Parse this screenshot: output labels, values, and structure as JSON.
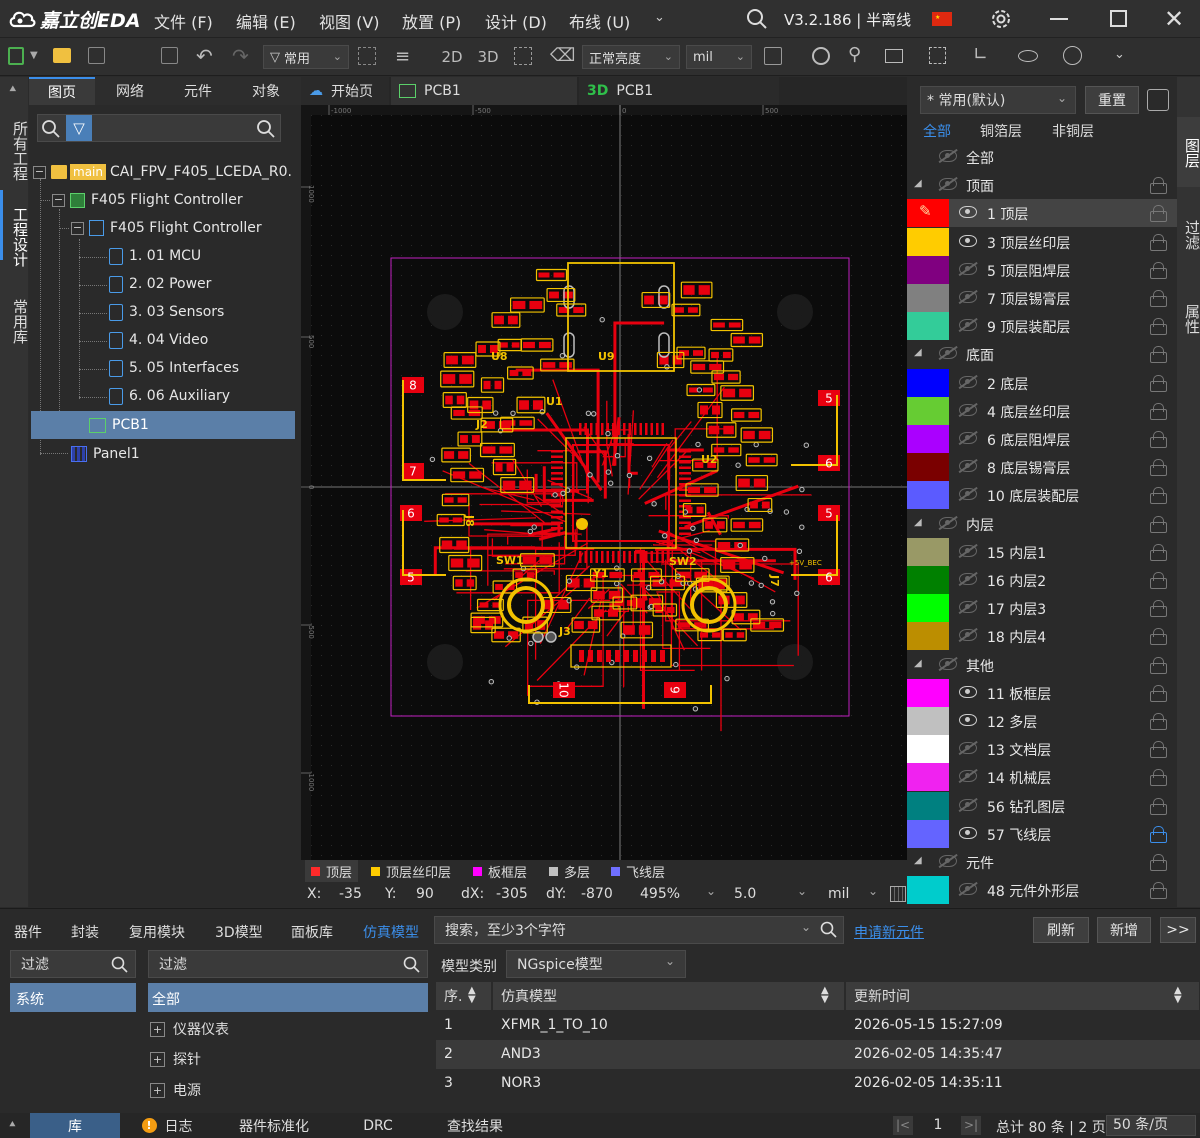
{
  "app": {
    "logo_text": "嘉立创EDA",
    "version_text": "V3.2.186 | 半离线"
  },
  "menu": [
    "文件 (F)",
    "编辑 (E)",
    "视图 (V)",
    "放置 (P)",
    "设计 (D)",
    "布线 (U)"
  ],
  "toolbar": {
    "filter_label": "常用",
    "view_2d": "2D",
    "view_3d": "3D",
    "brightness": "正常亮度",
    "unit": "mil"
  },
  "left_rail": [
    "所有工程",
    "工程设计",
    "常用库"
  ],
  "left_tabs": [
    "图页",
    "网络",
    "元件",
    "对象"
  ],
  "tree": {
    "root": {
      "branch": "main",
      "name": "CAI_FPV_F405_LCEDA_R0."
    },
    "board": "F405 Flight Controller",
    "schematic": "F405 Flight Controller",
    "sheets": [
      "1. 01 MCU",
      "2. 02 Power",
      "3. 03 Sensors",
      "4. 04 Video",
      "5. 05 Interfaces",
      "6. 06 Auxiliary"
    ],
    "pcb": "PCB1",
    "panel": "Panel1"
  },
  "doc_tabs": [
    "开始页",
    "PCB1",
    "PCB1"
  ],
  "doc_tab_prefix_3d": "3D",
  "ruler": {
    "h": [
      "-1000",
      "-500",
      "0",
      "500"
    ],
    "v": [
      "1000",
      "500",
      "0",
      "-500",
      "-1000"
    ]
  },
  "pcb_labels": {
    "refs": [
      "U8",
      "U9",
      "U1",
      "U2",
      "J2",
      "J8",
      "J7",
      "Y1",
      "SW1",
      "SW2",
      "J3"
    ],
    "pads": [
      "8",
      "7",
      "6",
      "5",
      "5",
      "6",
      "5",
      "6",
      "10",
      "9"
    ],
    "net": "+5V_BEC"
  },
  "layer_bar": [
    {
      "name": "顶层",
      "color": "#ff2a2a"
    },
    {
      "name": "顶层丝印层",
      "color": "#ffcc00"
    },
    {
      "name": "板框层",
      "color": "#ff00ff"
    },
    {
      "name": "多层",
      "color": "#c0c0c0"
    },
    {
      "name": "飞线层",
      "color": "#6f6fff"
    }
  ],
  "coords": {
    "x_label": "X:",
    "x": "-35",
    "y_label": "Y:",
    "y": "90",
    "dx_label": "dX:",
    "dx": "-305",
    "dy_label": "dY:",
    "dy": "-870",
    "zoom": "495%",
    "grid": "5.0",
    "unit": "mil"
  },
  "right_panel": {
    "preset": "* 常用(默认)",
    "reset": "重置",
    "filter_tabs": [
      "全部",
      "铜箔层",
      "非铜层"
    ],
    "all_label": "全部",
    "groups": {
      "top": "顶面",
      "bottom": "底面",
      "inner": "内层",
      "other": "其他",
      "component": "元件"
    },
    "layers": [
      {
        "name": "1 顶层",
        "color": "#ff0000",
        "visible": true
      },
      {
        "name": "3 顶层丝印层",
        "color": "#ffcc00",
        "visible": true
      },
      {
        "name": "5 顶层阻焊层",
        "color": "#800080",
        "visible": false
      },
      {
        "name": "7 顶层锡膏层",
        "color": "#808080",
        "visible": false
      },
      {
        "name": "9 顶层装配层",
        "color": "#33cc99",
        "visible": false
      },
      {
        "name": "2 底层",
        "color": "#0000ff",
        "visible": false
      },
      {
        "name": "4 底层丝印层",
        "color": "#66cc33",
        "visible": false
      },
      {
        "name": "6 底层阻焊层",
        "color": "#aa00ff",
        "visible": false
      },
      {
        "name": "8 底层锡膏层",
        "color": "#7a0000",
        "visible": false
      },
      {
        "name": "10 底层装配层",
        "color": "#5b5bff",
        "visible": false
      },
      {
        "name": "15 内层1",
        "color": "#999966",
        "visible": false
      },
      {
        "name": "16 内层2",
        "color": "#008000",
        "visible": false
      },
      {
        "name": "17 内层3",
        "color": "#00ff00",
        "visible": false
      },
      {
        "name": "18 内层4",
        "color": "#bc8e00",
        "visible": false
      },
      {
        "name": "11 板框层",
        "color": "#ff00ff",
        "visible": true
      },
      {
        "name": "12 多层",
        "color": "#c0c0c0",
        "visible": true
      },
      {
        "name": "13 文档层",
        "color": "#ffffff",
        "visible": false
      },
      {
        "name": "14 机械层",
        "color": "#f022f0",
        "visible": false
      },
      {
        "name": "56 钻孔图层",
        "color": "#008080",
        "visible": false
      },
      {
        "name": "57 飞线层",
        "color": "#6464ff",
        "visible": true
      },
      {
        "name": "48 元件外形层",
        "color": "#00cccc",
        "visible": false
      }
    ]
  },
  "right_rail": [
    "图层",
    "过滤",
    "属性"
  ],
  "bottom": {
    "tabs": [
      "器件",
      "封装",
      "复用模块",
      "3D模型",
      "面板库",
      "仿真模型"
    ],
    "search_placeholder": "搜索，至少3个字符",
    "apply_link": "申请新元件",
    "refresh": "刷新",
    "add": "新增",
    "more": ">>",
    "filter1": "过滤",
    "filter2": "过滤",
    "model_type_label": "模型类别",
    "model_type": "NGspice模型",
    "system": "系统",
    "category_all": "全部",
    "categories": [
      "仪器仪表",
      "探针",
      "电源"
    ],
    "table": {
      "headers": [
        "序.",
        "仿真模型",
        "更新时间"
      ],
      "rows": [
        {
          "no": "1",
          "model": "XFMR_1_TO_10",
          "time": "2026-05-15 15:27:09"
        },
        {
          "no": "2",
          "model": "AND3",
          "time": "2026-02-05 14:35:47"
        },
        {
          "no": "3",
          "model": "NOR3",
          "time": "2026-02-05 14:35:11"
        }
      ]
    }
  },
  "status": {
    "tabs": [
      "库",
      "日志",
      "器件标准化",
      "DRC",
      "查找结果"
    ],
    "page": "1",
    "total": "总计 80 条 | 2 页",
    "per_page": "50 条/页"
  }
}
